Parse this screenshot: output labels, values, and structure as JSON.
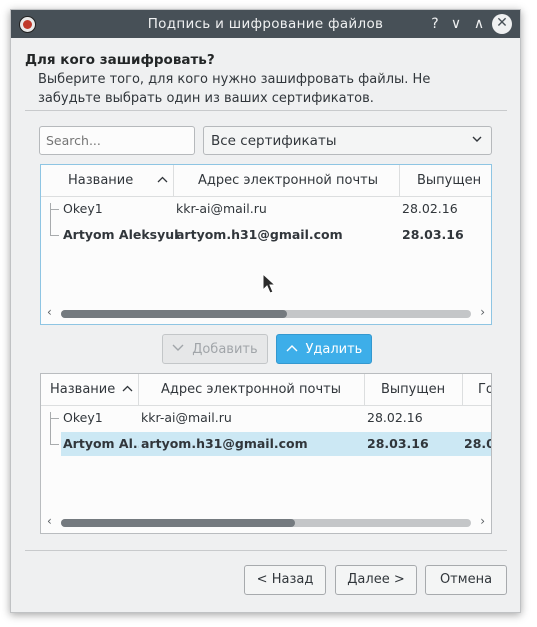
{
  "window": {
    "title": "Подпись и шифрование файлов",
    "controls": {
      "help": "?",
      "minimize": "∨",
      "maximize": "∧",
      "close": "✕"
    }
  },
  "heading": "Для кого зашифровать?",
  "description": "Выберите того, для кого нужно зашифровать файлы. Не забудьте выбрать один из ваших сертификатов.",
  "search": {
    "placeholder": "Search..."
  },
  "filter": {
    "selected": "Все сертификаты",
    "icon": "chevron-down-icon"
  },
  "available_table": {
    "columns": [
      "Название",
      "Адрес электронной почты",
      "Выпущен"
    ],
    "rows": [
      {
        "name": "Okey1",
        "email": "kkr-ai@mail.ru",
        "issued": "28.02.16",
        "bold": false
      },
      {
        "name": "Artyom Aleksyuk",
        "email": "artyom.h31@gmail.com",
        "issued": "28.03.16",
        "bold": true
      }
    ],
    "scroll_thumb_fraction": 0.55
  },
  "actions": {
    "add_label": "Добавить",
    "remove_label": "Удалить"
  },
  "recipients_table": {
    "columns": [
      "Название",
      "Адрес электронной почты",
      "Выпущен",
      "Го"
    ],
    "rows": [
      {
        "name": "Okey1",
        "email": "kkr-ai@mail.ru",
        "issued": "28.02.16",
        "valid": "",
        "bold": false,
        "selected": false
      },
      {
        "name": "Artyom Al...",
        "email": "artyom.h31@gmail.com",
        "issued": "28.03.16",
        "valid": "28.0",
        "bold": true,
        "selected": true
      }
    ],
    "scroll_thumb_fraction": 0.57
  },
  "footer": {
    "back_label": "< Назад",
    "next_label": "Далее >",
    "cancel_label": "Отмена"
  }
}
